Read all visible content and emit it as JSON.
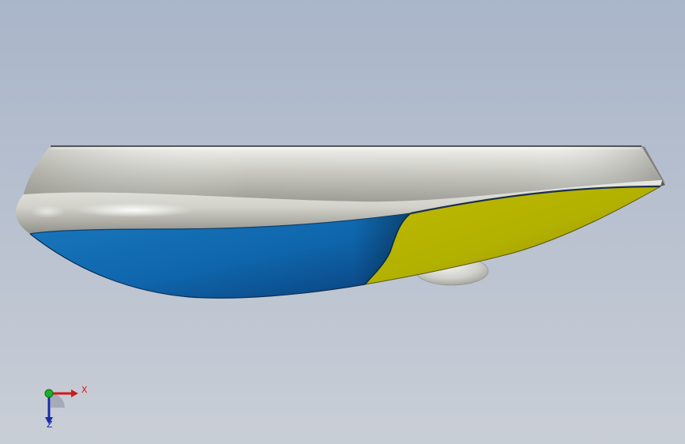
{
  "view": {
    "background_top": "#a9b5c9",
    "background_bottom": "#c9ced6"
  },
  "model": {
    "colors": {
      "shell": "#c9c9c3",
      "blue_face": "#0f69b0",
      "yellow_face": "#b6b400",
      "bulge": "#cfcfca"
    }
  },
  "triad": {
    "x_label": "X",
    "y_label": "",
    "z_label": "Z",
    "x_color": "#d11a1a",
    "y_color": "#1a9a1a",
    "z_color": "#1a2aa8"
  }
}
